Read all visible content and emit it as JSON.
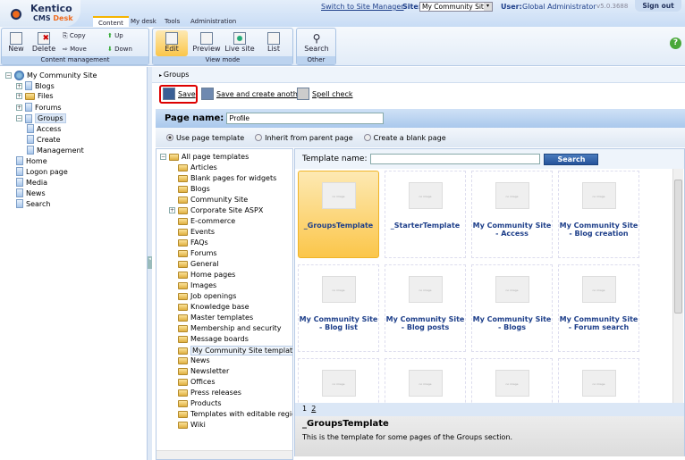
{
  "header": {
    "logo_line1": "Kentico",
    "logo_line2": "CMS",
    "logo_line3": "Desk",
    "tabs": [
      "Content",
      "My desk",
      "Tools",
      "Administration"
    ],
    "switch_link": "Switch to Site Manager",
    "site_label": "Site:",
    "site_value": "My Community Site",
    "user_label": "User:",
    "user_value": "Global Administrator",
    "version": "v5.0.3688",
    "signout": "Sign out"
  },
  "toolbar": {
    "content_management": {
      "label": "Content management",
      "new": "New",
      "delete": "Delete",
      "copy": "Copy",
      "move": "Move",
      "up": "Up",
      "down": "Down"
    },
    "view_mode": {
      "label": "View mode",
      "edit": "Edit",
      "preview": "Preview",
      "live_site": "Live site",
      "list": "List"
    },
    "other": {
      "label": "Other",
      "search": "Search"
    }
  },
  "site_tree": {
    "root": "My Community Site",
    "items": [
      "Blogs",
      "Files",
      "Forums",
      "Groups",
      "Access",
      "Create",
      "Management",
      "Home",
      "Logon page",
      "Media",
      "News",
      "Search"
    ]
  },
  "breadcrumb": "Groups",
  "actions": {
    "save": "Save",
    "save_another": "Save and create another",
    "spell": "Spell check"
  },
  "page_name": {
    "label": "Page name:",
    "value": "Profile"
  },
  "radios": [
    "Use page template",
    "Inherit from parent page",
    "Create a blank page"
  ],
  "template_tree": {
    "root": "All page templates",
    "items": [
      "Articles",
      "Blank pages for widgets",
      "Blogs",
      "Community Site",
      "Corporate Site ASPX",
      "E-commerce",
      "Events",
      "FAQs",
      "Forums",
      "General",
      "Home pages",
      "Images",
      "Job openings",
      "Knowledge base",
      "Master templates",
      "Membership and security",
      "Message boards",
      "My Community Site templates",
      "News",
      "Newsletter",
      "Offices",
      "Press releases",
      "Products",
      "Templates with editable regio",
      "Wiki"
    ]
  },
  "template_search": {
    "label": "Template name:",
    "value": "",
    "button": "Search"
  },
  "no_image": "no image",
  "templates": [
    "_GroupsTemplate",
    "_StarterTemplate",
    "My Community Site - Access",
    "My Community Site - Blog creation",
    "My Community Site - Blog list",
    "My Community Site - Blog posts",
    "My Community Site - Blogs",
    "My Community Site - Forum search"
  ],
  "pager": [
    "1",
    "2"
  ],
  "selected": {
    "title": "_GroupsTemplate",
    "description": "This is the template for some pages of the Groups section."
  }
}
